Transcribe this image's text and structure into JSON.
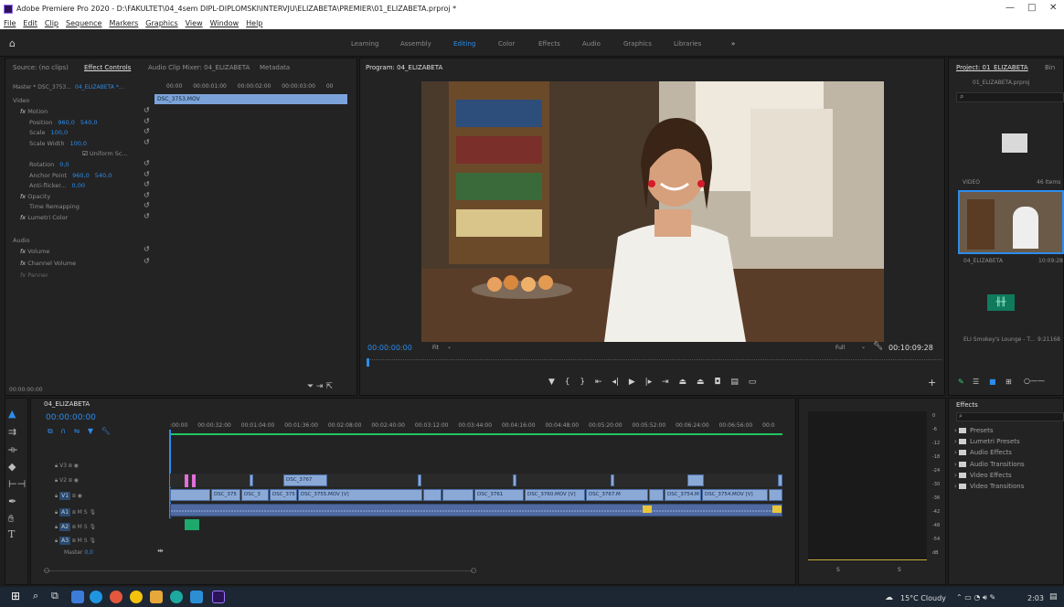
{
  "window": {
    "title": "Adobe Premiere Pro 2020 - D:\\FAKULTET\\04_4sem DIPL-DIPLOMSKI\\INTERVJU\\ELIZABETA\\PREMIER\\01_ELIZABETA.prproj *",
    "controls": [
      "—",
      "□",
      "✕"
    ]
  },
  "menu": [
    "File",
    "Edit",
    "Clip",
    "Sequence",
    "Markers",
    "Graphics",
    "View",
    "Window",
    "Help"
  ],
  "workspaces": [
    "Learning",
    "Assembly",
    "Editing",
    "Color",
    "Effects",
    "Audio",
    "Graphics",
    "Libraries",
    "»"
  ],
  "left_panel": {
    "tabs": [
      "Source: (no clips)",
      "Effect Controls",
      "Audio Clip Mixer: 04_ELIZABETA",
      "Metadata"
    ],
    "master": "Master * DSC_3753...",
    "seq": "04_ELIZABETA *...",
    "clip": "DSC_3753.MOV",
    "timecodes": [
      "00:00",
      "00:00:01:00",
      "00:00:02:00",
      "00:00:03:00",
      "00"
    ],
    "video_label": "Video",
    "audio_label": "Audio",
    "rows": [
      {
        "label": "Motion",
        "fx": true,
        "val": ""
      },
      {
        "label": "Position",
        "val": "960,0",
        "val2": "540,0"
      },
      {
        "label": "Scale",
        "val": "100,0"
      },
      {
        "label": "Scale Width",
        "val": "100,0"
      },
      {
        "label": "Uniform Sc...",
        "check": true
      },
      {
        "label": "Rotation",
        "val": "0,0"
      },
      {
        "label": "Anchor Point",
        "val": "960,0",
        "val2": "540,0"
      },
      {
        "label": "Anti-flicker...",
        "val": "0,00"
      },
      {
        "label": "Opacity",
        "fx": true
      },
      {
        "label": "Time Remapping"
      },
      {
        "label": "Lumetri Color",
        "fx": true
      }
    ],
    "audio_rows": [
      "Volume",
      "Channel Volume",
      "Panner"
    ],
    "bottom_tc": "00:00:00:00"
  },
  "program": {
    "title": "Program: 04_ELIZABETA",
    "tc_left": "00:00:00:00",
    "fit": "Fit",
    "quality": "Full",
    "tc_right": "00:10:09:28"
  },
  "project": {
    "title": "Project: 01_ELIZABETA",
    "bin": "Bin",
    "file": "01_ELIZABETA.prproj",
    "folder_label": "VIDEO",
    "folder_count": "46 Items",
    "clip_name": "04_ELIZABETA",
    "clip_dur": "10:09:28",
    "audio_name": "ELI Smokey's Lounge - T...",
    "audio_dur": "9:21168"
  },
  "effects": {
    "title": "Effects",
    "items": [
      "Presets",
      "Lumetri Presets",
      "Audio Effects",
      "Audio Transitions",
      "Video Effects",
      "Video Transitions"
    ]
  },
  "timeline": {
    "tab": "04_ELIZABETA",
    "tc": "00:00:00:00",
    "ruler": [
      ":00:00",
      "00:00:32:00",
      "00:01:04:00",
      "00:01:36:00",
      "00:02:08:00",
      "00:02:40:00",
      "00:03:12:00",
      "00:03:44:00",
      "00:04:16:00",
      "00:04:48:00",
      "00:05:20:00",
      "00:05:52:00",
      "00:06:24:00",
      "00:06:56:00",
      "00:0"
    ],
    "tracks": [
      "V3",
      "V2",
      "V1",
      "A1",
      "A2",
      "A3"
    ],
    "master": "Master",
    "master_val": "0,0",
    "v1_clips": [
      "DSC_375",
      "DSC_3",
      "DSC_375",
      "DSC_3755.MOV [V]",
      "DSC_3761",
      "DSC_3760.MOV [V]",
      "DSC_3767.M",
      "DSC_3754.M",
      "DSC_3754.MOV [V]"
    ],
    "v2_clip": "DSC_3767",
    "meter": [
      "0",
      "-6",
      "-12",
      "-18",
      "-24",
      "-30",
      "-36",
      "-42",
      "-48",
      "-54",
      "dB"
    ],
    "meter_s": [
      "S",
      "S"
    ]
  },
  "taskbar": {
    "weather": "15°C Cloudy",
    "time": "2:03"
  }
}
